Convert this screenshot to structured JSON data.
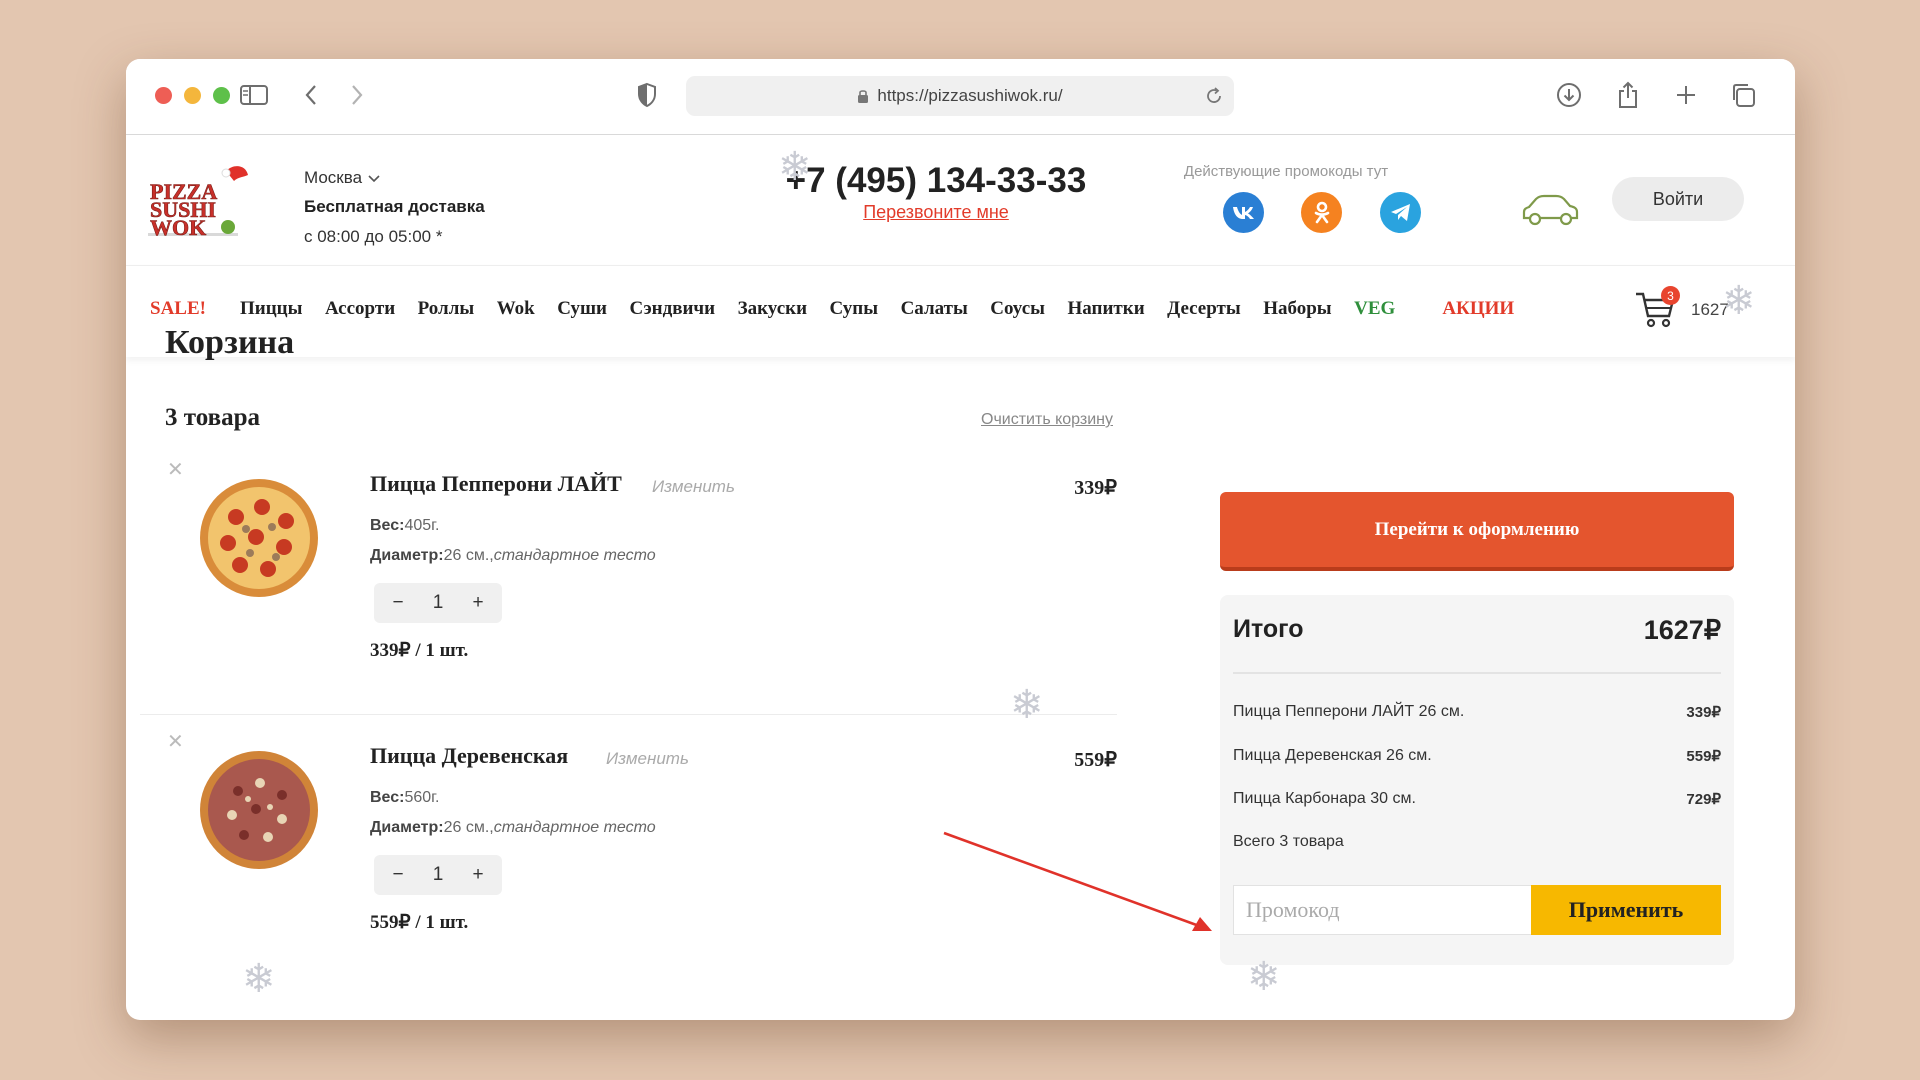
{
  "browser": {
    "url": "https://pizzasushiwok.ru/"
  },
  "header": {
    "city": "Москва",
    "delivery": "Бесплатная доставка",
    "hours": "с 08:00 до 05:00 *",
    "phone": "+7 (495) 134-33-33",
    "callback": "Перезвоните мне",
    "promo_label": "Действующие промокоды тут",
    "login": "Войти",
    "social": [
      "vk-icon",
      "ok-icon",
      "telegram-icon"
    ]
  },
  "nav": {
    "items": [
      "SALE!",
      "Пиццы",
      "Ассорти",
      "Роллы",
      "Wok",
      "Суши",
      "Сэндвичи",
      "Закуски",
      "Супы",
      "Салаты",
      "Соусы",
      "Напитки",
      "Десерты",
      "Наборы",
      "VEG",
      "АКЦИИ"
    ],
    "cart_count": "3",
    "cart_total": "1627"
  },
  "cart": {
    "title": "Корзина",
    "count": "3 товара",
    "clear": "Очистить корзину",
    "items": [
      {
        "name": "Пицца Пепперони ЛАЙТ",
        "edit": "Изменить",
        "price": "339₽",
        "weight_label": "Вес:",
        "weight": "405г.",
        "diam_label": "Диаметр:",
        "diam": "26 см.",
        "dough": "стандартное тесто",
        "qty": "1",
        "unit": "339₽ / 1 шт."
      },
      {
        "name": "Пицца Деревенская",
        "edit": "Изменить",
        "price": "559₽",
        "weight_label": "Вес:",
        "weight": "560г.",
        "diam_label": "Диаметр:",
        "diam": "26 см.",
        "dough": "стандартное тесто",
        "qty": "1",
        "unit": "559₽ / 1 шт."
      }
    ]
  },
  "summary": {
    "checkout": "Перейти к оформлению",
    "title": "Итого",
    "total": "1627₽",
    "rows": [
      {
        "name": "Пицца Пепперони ЛАЙТ 26 см.",
        "value": "339₽"
      },
      {
        "name": "Пицца Деревенская 26 см.",
        "value": "559₽"
      },
      {
        "name": "Пицца Карбонара 30 см.",
        "value": "729₽"
      }
    ],
    "items_count": "Всего 3 товара",
    "promo_placeholder": "Промокод",
    "apply": "Применить"
  },
  "colors": {
    "accent": "#e4552e",
    "sale": "#e23b2a",
    "veg": "#2f8f3c",
    "apply": "#f7b800",
    "background": "#e3c6b0"
  }
}
